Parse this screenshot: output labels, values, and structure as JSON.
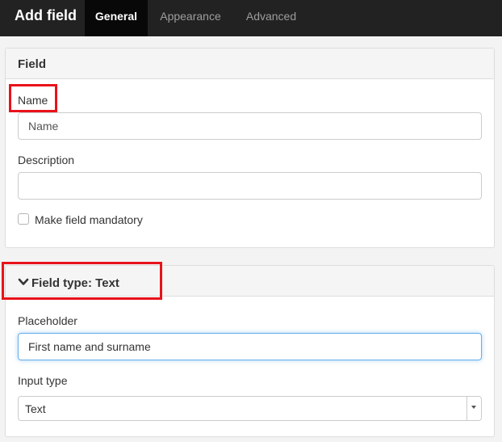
{
  "header": {
    "title": "Add field",
    "tabs": [
      {
        "label": "General",
        "active": true
      },
      {
        "label": "Appearance",
        "active": false
      },
      {
        "label": "Advanced",
        "active": false
      }
    ]
  },
  "field_panel": {
    "heading": "Field",
    "name_label": "Name",
    "name_placeholder": "Name",
    "name_value": "",
    "description_label": "Description",
    "description_value": "",
    "mandatory_label": "Make field mandatory",
    "mandatory_checked": false
  },
  "type_panel": {
    "heading": "Field type: Text",
    "heading_icon": "chevron-down-icon",
    "placeholder_label": "Placeholder",
    "placeholder_value": "First name and surname",
    "input_type_label": "Input type",
    "input_type_value": "Text"
  },
  "colors": {
    "header_bg": "#222222",
    "active_tab_bg": "#080808",
    "highlight": "#e8121b",
    "focus_border": "#66afe9"
  }
}
